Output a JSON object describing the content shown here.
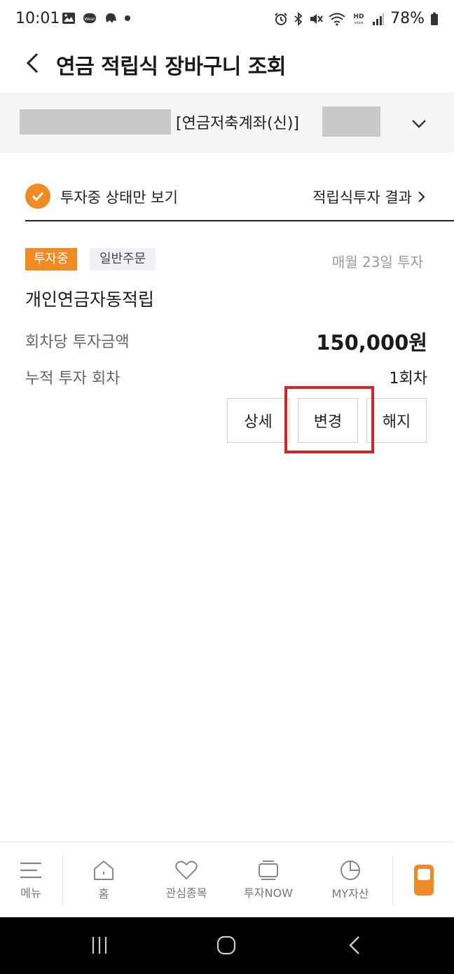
{
  "status_bar": {
    "time": "10:01",
    "battery": "78%",
    "icons": [
      "gallery-icon",
      "wear-icon",
      "notification-icon",
      "alarm-icon",
      "bluetooth-icon",
      "mute-icon",
      "wifi-icon",
      "hd-voice-icon",
      "signal-icon",
      "battery-icon"
    ]
  },
  "header": {
    "title": "연금 적립식 장바구니 조회",
    "back_icon": "back-arrow-icon"
  },
  "account": {
    "name": "[연금저축계좌(신)]",
    "chevron_icon": "chevron-down-icon"
  },
  "filter": {
    "label": "투자중 상태만 보기",
    "checked": true,
    "result_link": "적립식투자 결과",
    "accent_color": "#f08a24"
  },
  "card": {
    "status_badge": "투자중",
    "type_badge": "일반주문",
    "schedule": "매월 23일 투자",
    "product_name": "개인연금자동적립",
    "amount_label": "회차당 투자금액",
    "amount_value": "150,000원",
    "count_label": "누적 투자 회차",
    "count_value": "1회차",
    "buttons": {
      "detail": "상세",
      "change": "변경",
      "cancel": "해지"
    }
  },
  "bottom_nav": {
    "items": [
      {
        "label": "메뉴",
        "icon": "menu-icon"
      },
      {
        "label": "홈",
        "icon": "home-icon"
      },
      {
        "label": "관심종목",
        "icon": "heart-icon"
      },
      {
        "label": "투자NOW",
        "icon": "tv-icon"
      },
      {
        "label": "MY자산",
        "icon": "pie-chart-icon"
      }
    ],
    "special_icon": "phone-app-icon"
  },
  "system_nav": {
    "icons": [
      "recents-icon",
      "home-circle-icon",
      "back-icon"
    ]
  }
}
